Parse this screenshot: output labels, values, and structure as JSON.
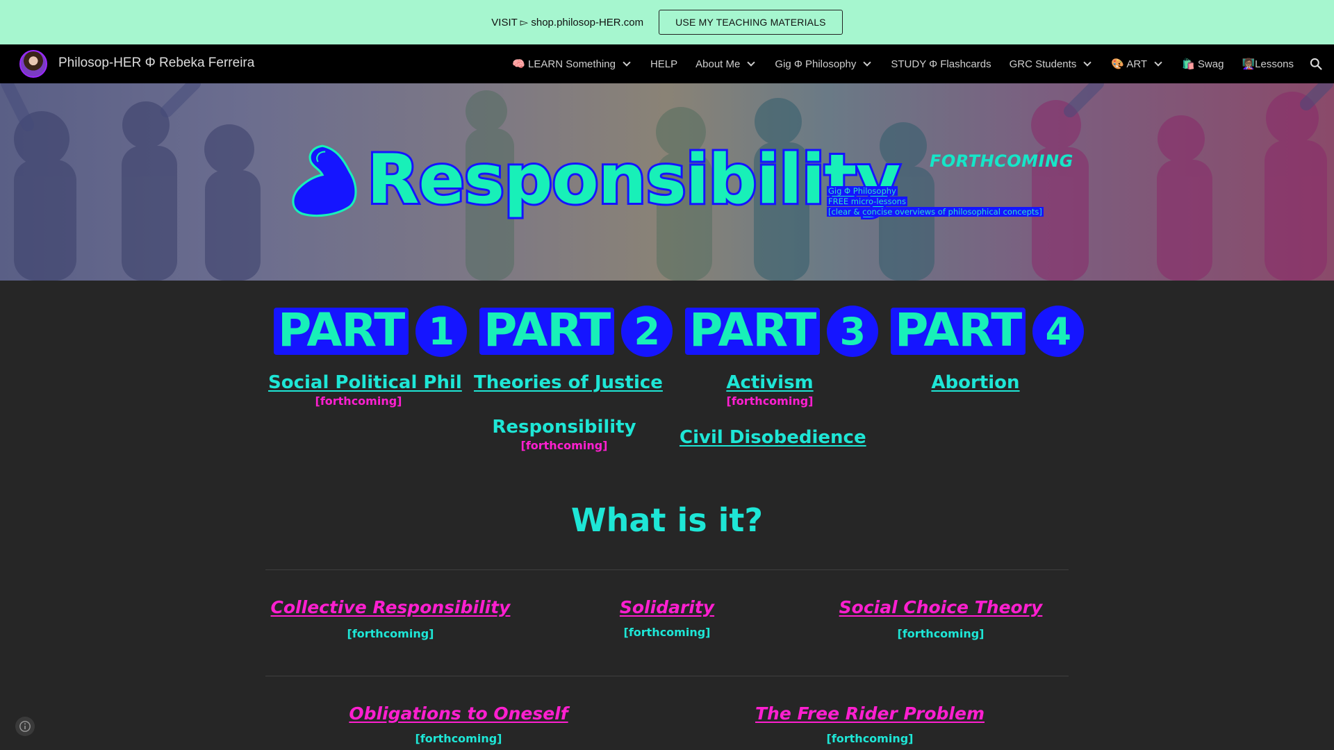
{
  "banner": {
    "visit_text": "VISIT ▻ shop.philosop-HER.com",
    "button_label": "USE MY TEACHING MATERIALS"
  },
  "nav": {
    "site_title": "Philosop-HER Φ Rebeka Ferreira",
    "items": [
      {
        "label": "🧠 LEARN Something",
        "dropdown": true
      },
      {
        "label": "HELP",
        "dropdown": false
      },
      {
        "label": "About Me",
        "dropdown": true
      },
      {
        "label": "Gig Φ Philosophy",
        "dropdown": true
      },
      {
        "label": "STUDY Φ Flashcards",
        "dropdown": false
      },
      {
        "label": "GRC Students",
        "dropdown": true
      },
      {
        "label": "🎨 ART",
        "dropdown": true
      },
      {
        "label": "🛍️ Swag",
        "dropdown": false
      },
      {
        "label": "👩🏽‍🏫Lessons",
        "dropdown": false
      }
    ]
  },
  "hero": {
    "title": "Responsibility",
    "forthcoming": "FORTHCOMING",
    "lines": [
      "Gig Φ Philosophy",
      "FREE micro-lessons",
      "[clear & concise overviews of philosophical concepts]"
    ]
  },
  "parts": [
    {
      "word": "PART",
      "number": "1"
    },
    {
      "word": "PART",
      "number": "2"
    },
    {
      "word": "PART",
      "number": "3"
    },
    {
      "word": "PART",
      "number": "4"
    }
  ],
  "columns": {
    "part1": {
      "link": "Social Political Phil",
      "note": "[forthcoming]"
    },
    "part2": {
      "link": "Theories of Justice",
      "sub_title": "Responsibility",
      "sub_note": "[forthcoming]"
    },
    "part3": {
      "link": "Activism",
      "note": "[forthcoming]",
      "link2": "Civil Disobedience"
    },
    "part4": {
      "link": "Abortion"
    }
  },
  "section_heading": "What is it?",
  "topics_row1": [
    {
      "title": "Collective Responsibility",
      "note": "[forthcoming]"
    },
    {
      "title": "Solidarity",
      "note": "[forthcoming]"
    },
    {
      "title": "Social Choice Theory",
      "note": "[forthcoming]"
    }
  ],
  "topics_row2": [
    {
      "title": "Obligations to Oneself",
      "note": "[forthcoming]"
    },
    {
      "title": "The Free Rider Problem",
      "note": "[forthcoming]"
    }
  ]
}
